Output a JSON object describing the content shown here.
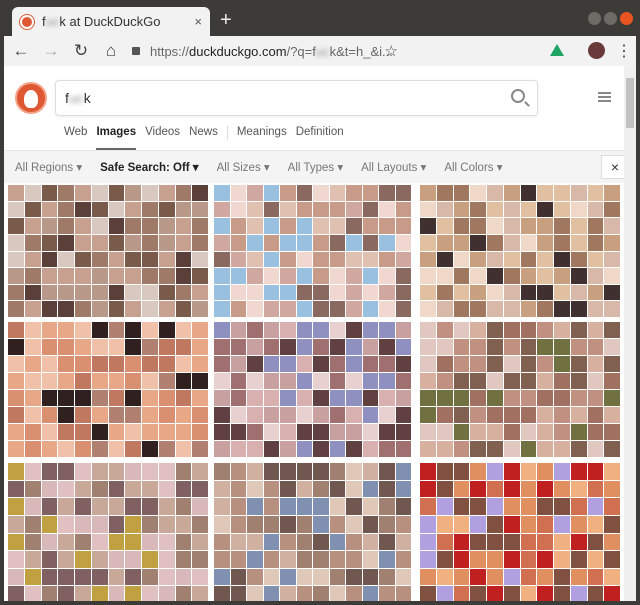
{
  "tab": {
    "title_prefix": "f",
    "title_blur": "uc",
    "title_suffix": "k at DuckDuckGo",
    "close": "×",
    "new_tab": "+"
  },
  "toolbar": {
    "url_scheme": "https://",
    "url_host": "duckduckgo.com",
    "url_rest_prefix": "/?q=f",
    "url_blur": "uc",
    "url_rest_suffix": "k&t=h_&i...",
    "back": "←",
    "forward": "→",
    "reload": "↻",
    "home": "⌂",
    "star": "☆",
    "more": "⋮"
  },
  "search": {
    "prefix": "f",
    "blur": "uc",
    "suffix": "k"
  },
  "nav": [
    "Web",
    "Images",
    "Videos",
    "News",
    "Meanings",
    "Definition"
  ],
  "filters": [
    "All Regions ▾",
    "Safe Search: Off ▾",
    "All Sizes ▾",
    "All Types ▾",
    "All Layouts ▾",
    "All Colors ▾"
  ],
  "close_filters": "×",
  "images": [
    {
      "palette": [
        "#7a5a4a",
        "#a07a68",
        "#c8a090",
        "#d8c8c0",
        "#5a4038",
        "#b89888"
      ]
    },
    {
      "palette": [
        "#c89a88",
        "#e0c0b0",
        "#9ac0e0",
        "#d0a8a0",
        "#8a6a60",
        "#f0d8d0"
      ]
    },
    {
      "palette": [
        "#c8a080",
        "#e0c0a0",
        "#a07860",
        "#d8b8a8",
        "#403030",
        "#f0d8c8"
      ]
    },
    {
      "palette": [
        "#e8a888",
        "#d89070",
        "#f0c0a8",
        "#c07860",
        "#b08070",
        "#302020"
      ]
    },
    {
      "palette": [
        "#604040",
        "#c8a0a0",
        "#9090c0",
        "#d8b0b0",
        "#a07070",
        "#e8d0d0"
      ]
    },
    {
      "palette": [
        "#a07060",
        "#c09080",
        "#707040",
        "#d8b0a0",
        "#806050",
        "#e0c8c0"
      ]
    },
    {
      "palette": [
        "#c8a898",
        "#a08070",
        "#c0a040",
        "#d8b8b8",
        "#806060",
        "#e0c0c0"
      ]
    },
    {
      "palette": [
        "#a08070",
        "#b89080",
        "#8090b0",
        "#d0b0a0",
        "#705850",
        "#e0c8b8"
      ]
    },
    {
      "palette": [
        "#e09060",
        "#f0b080",
        "#b0a0e0",
        "#c02020",
        "#d07050",
        "#805040"
      ]
    }
  ]
}
